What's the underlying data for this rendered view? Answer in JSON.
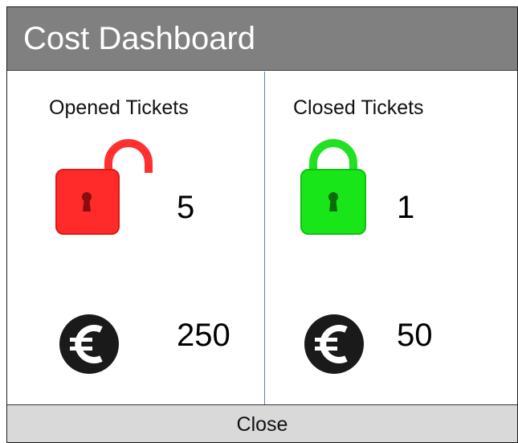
{
  "window": {
    "title": "Cost Dashboard"
  },
  "opened": {
    "heading": "Opened Tickets",
    "icon": "unlocked-padlock-icon",
    "count": "5",
    "currency_icon": "euro-icon",
    "cost": "250",
    "color": "#ff2b2b"
  },
  "closed": {
    "heading": "Closed Tickets",
    "icon": "locked-padlock-icon",
    "count": "1",
    "currency_icon": "euro-icon",
    "cost": "50",
    "color": "#19e619"
  },
  "footer": {
    "close_label": "Close"
  },
  "colors": {
    "titlebar": "#808080",
    "divider": "#5b84b8",
    "footer": "#d9d9d9",
    "euro_badge": "#1a1a1a"
  }
}
